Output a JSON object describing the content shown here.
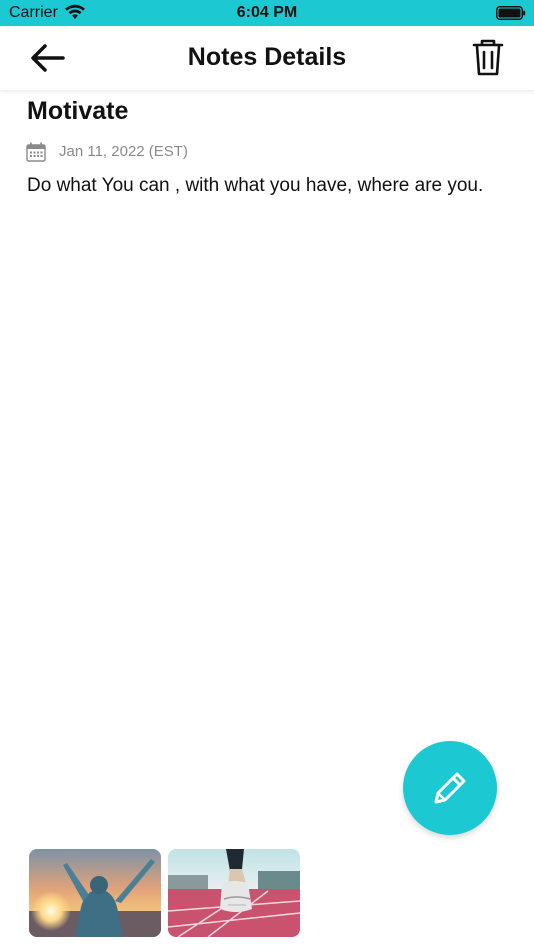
{
  "status_bar": {
    "carrier": "Carrier",
    "time": "6:04 PM",
    "icons": [
      "wifi-icon",
      "battery-icon"
    ]
  },
  "header": {
    "title": "Notes Details",
    "back_icon": "arrow-left-icon",
    "delete_icon": "trash-icon"
  },
  "note": {
    "title": "Motivate",
    "date_icon": "calendar-icon",
    "date": "Jan 11, 2022 (EST)",
    "body": "Do what You can , with what you have, where are you."
  },
  "fab": {
    "icon": "pencil-icon"
  },
  "attachments": [
    {
      "icon": "photo-person-sunset"
    },
    {
      "icon": "photo-runner-track"
    }
  ],
  "colors": {
    "accent": "#1cc9d3",
    "text": "#111111",
    "muted": "#8a8a8a",
    "background": "#ffffff"
  }
}
